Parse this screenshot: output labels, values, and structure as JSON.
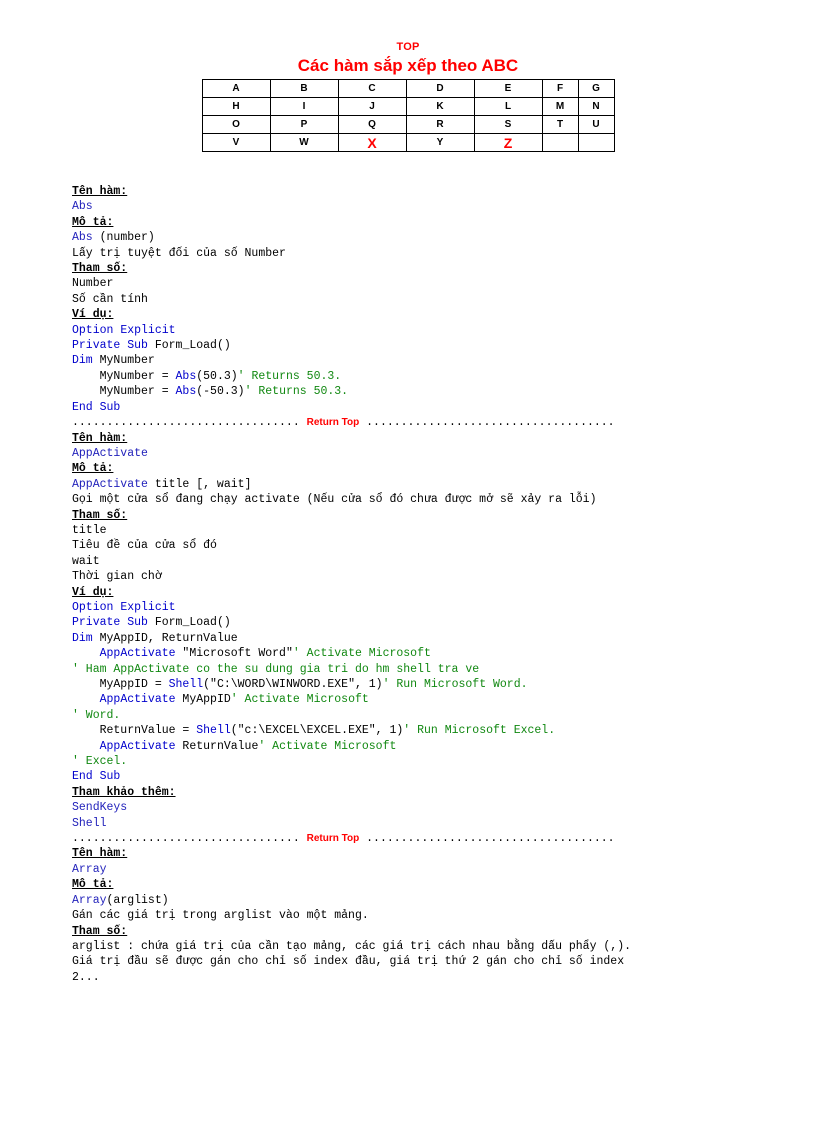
{
  "header": {
    "top_label": "TOP",
    "title": "Các hàm sắp xếp theo ABC",
    "alphabet_rows": [
      [
        "A",
        "B",
        "C",
        "D",
        "E",
        "F",
        "G"
      ],
      [
        "H",
        "I",
        "J",
        "K",
        "L",
        "M",
        "N"
      ],
      [
        "O",
        "P",
        "Q",
        "R",
        "S",
        "T",
        "U"
      ],
      [
        "V",
        "W",
        "X",
        "Y",
        "Z",
        "",
        ""
      ]
    ],
    "highlighted_letters": [
      "X",
      "Z"
    ]
  },
  "labels": {
    "ten_ham": "Tên hàm:",
    "mo_ta": "Mô tả:",
    "tham_so": "Tham số:",
    "vi_du": "Ví dụ:",
    "tham_khao_them": "Tham khảo thêm:"
  },
  "separator": {
    "dots_left": ".................................",
    "return_top": "Return Top",
    "dots_right": "...................................."
  },
  "sections": [
    {
      "name": "Abs",
      "ten_ham_value": "Abs",
      "mo_ta": {
        "signature_fn": "Abs",
        "signature_args": " (number)",
        "description": "Lấy trị tuyệt đối của số Number"
      },
      "tham_so": [
        "Number",
        "Số cần tính"
      ],
      "vi_du": [
        {
          "parts": [
            {
              "t": "Option",
              "c": "kw"
            },
            {
              "t": " Explicit",
              "c": "kw"
            }
          ]
        },
        {
          "parts": [
            {
              "t": "Private",
              "c": "kw"
            },
            {
              "t": " ",
              "c": "plain"
            },
            {
              "t": "Sub",
              "c": "kw"
            },
            {
              "t": " Form_Load()",
              "c": "plain"
            }
          ]
        },
        {
          "parts": [
            {
              "t": "Dim",
              "c": "kw"
            },
            {
              "t": " MyNumber",
              "c": "plain"
            }
          ]
        },
        {
          "parts": [
            {
              "t": "    MyNumber = ",
              "c": "plain"
            },
            {
              "t": "Abs",
              "c": "kw"
            },
            {
              "t": "(50.3)",
              "c": "plain"
            },
            {
              "t": "' Returns 50.3.",
              "c": "cmt"
            }
          ]
        },
        {
          "parts": [
            {
              "t": "    MyNumber = ",
              "c": "plain"
            },
            {
              "t": "Abs",
              "c": "kw"
            },
            {
              "t": "(-50.3)",
              "c": "plain"
            },
            {
              "t": "' Returns 50.3.",
              "c": "cmt"
            }
          ]
        },
        {
          "parts": [
            {
              "t": "End",
              "c": "kw"
            },
            {
              "t": " ",
              "c": "plain"
            },
            {
              "t": "Sub",
              "c": "kw"
            }
          ]
        }
      ],
      "tham_khao_them": []
    },
    {
      "name": "AppActivate",
      "ten_ham_value": "AppActivate",
      "mo_ta": {
        "signature_fn": "AppActivate",
        "signature_args": " title [, wait]",
        "description": "Gọi một cửa sổ đang chạy activate (Nếu cửa sổ đó chưa được mở sẽ xảy ra lỗi)"
      },
      "tham_so": [
        "title",
        "Tiêu đề của cửa sổ đó",
        "wait",
        "Thời gian chờ"
      ],
      "vi_du": [
        {
          "parts": [
            {
              "t": "Option",
              "c": "kw"
            },
            {
              "t": " Explicit",
              "c": "kw"
            }
          ]
        },
        {
          "parts": [
            {
              "t": "Private",
              "c": "kw"
            },
            {
              "t": " ",
              "c": "plain"
            },
            {
              "t": "Sub",
              "c": "kw"
            },
            {
              "t": " Form_Load()",
              "c": "plain"
            }
          ]
        },
        {
          "parts": [
            {
              "t": "Dim",
              "c": "kw"
            },
            {
              "t": " MyAppID, ReturnValue",
              "c": "plain"
            }
          ]
        },
        {
          "parts": [
            {
              "t": "    ",
              "c": "plain"
            },
            {
              "t": "AppActivate",
              "c": "kw"
            },
            {
              "t": " \"Microsoft Word\"",
              "c": "plain"
            },
            {
              "t": "' Activate Microsoft",
              "c": "cmt"
            }
          ]
        },
        {
          "parts": [
            {
              "t": "' Ham AppActivate co the su dung gia tri do hm shell tra ve",
              "c": "cmt"
            }
          ]
        },
        {
          "parts": [
            {
              "t": "    MyAppID = ",
              "c": "plain"
            },
            {
              "t": "Shell",
              "c": "kw"
            },
            {
              "t": "(\"C:\\WORD\\WINWORD.EXE\", 1)",
              "c": "plain"
            },
            {
              "t": "' Run Microsoft Word.",
              "c": "cmt"
            }
          ]
        },
        {
          "parts": [
            {
              "t": "    ",
              "c": "plain"
            },
            {
              "t": "AppActivate",
              "c": "kw"
            },
            {
              "t": " MyAppID",
              "c": "plain"
            },
            {
              "t": "' Activate Microsoft",
              "c": "cmt"
            }
          ]
        },
        {
          "parts": [
            {
              "t": "' Word.",
              "c": "cmt"
            }
          ]
        },
        {
          "parts": [
            {
              "t": "    ReturnValue = ",
              "c": "plain"
            },
            {
              "t": "Shell",
              "c": "kw"
            },
            {
              "t": "(\"c:\\EXCEL\\EXCEL.EXE\", 1)",
              "c": "plain"
            },
            {
              "t": "' Run Microsoft Excel.",
              "c": "cmt"
            }
          ]
        },
        {
          "parts": [
            {
              "t": "    ",
              "c": "plain"
            },
            {
              "t": "AppActivate",
              "c": "kw"
            },
            {
              "t": " ReturnValue",
              "c": "plain"
            },
            {
              "t": "' Activate Microsoft",
              "c": "cmt"
            }
          ]
        },
        {
          "parts": [
            {
              "t": "' Excel.",
              "c": "cmt"
            }
          ]
        },
        {
          "parts": [
            {
              "t": "End",
              "c": "kw"
            },
            {
              "t": " ",
              "c": "plain"
            },
            {
              "t": "Sub",
              "c": "kw"
            }
          ]
        }
      ],
      "tham_khao_them": [
        "SendKeys",
        "Shell"
      ]
    },
    {
      "name": "Array",
      "ten_ham_value": "Array",
      "mo_ta": {
        "signature_fn": "Array",
        "signature_args": "(arglist)",
        "description": "Gán các giá trị trong arglist vào một mảng."
      },
      "tham_so": [
        "arglist : chứa giá trị của cần tạo mảng, các giá trị cách nhau bằng dấu phẩy (,).",
        "Giá trị đầu sẽ được gán cho chỉ số index đầu, giá trị thứ 2 gán cho chỉ số index",
        "2..."
      ],
      "vi_du": [],
      "tham_khao_them": []
    }
  ],
  "colors": {
    "accent_red": "#ff0000",
    "link_blue": "#2222bb",
    "keyword_blue": "#0000cc",
    "comment_green": "#118811"
  }
}
